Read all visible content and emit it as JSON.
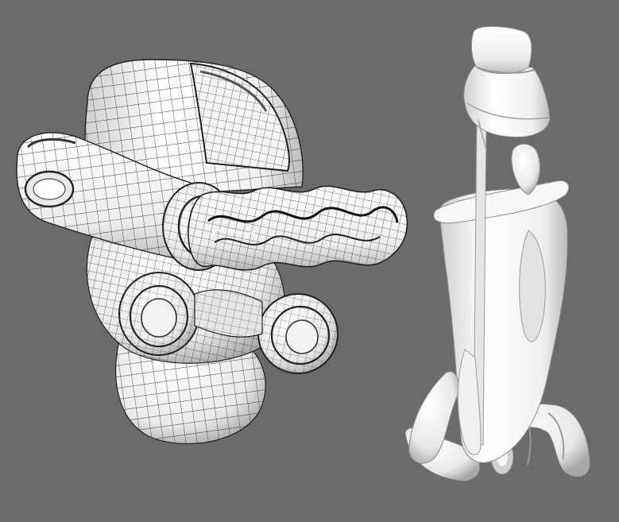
{
  "scene": {
    "background": "#6b6b6b",
    "model_color": "#f4f4f4",
    "wire_color": "#1a1a1a",
    "shade_color": "#bdbdbd",
    "objects": [
      {
        "name": "wireframe-mask-model",
        "display": "shaded-with-wireframe"
      },
      {
        "name": "smooth-sculpture-model",
        "display": "smooth-shaded"
      }
    ]
  }
}
